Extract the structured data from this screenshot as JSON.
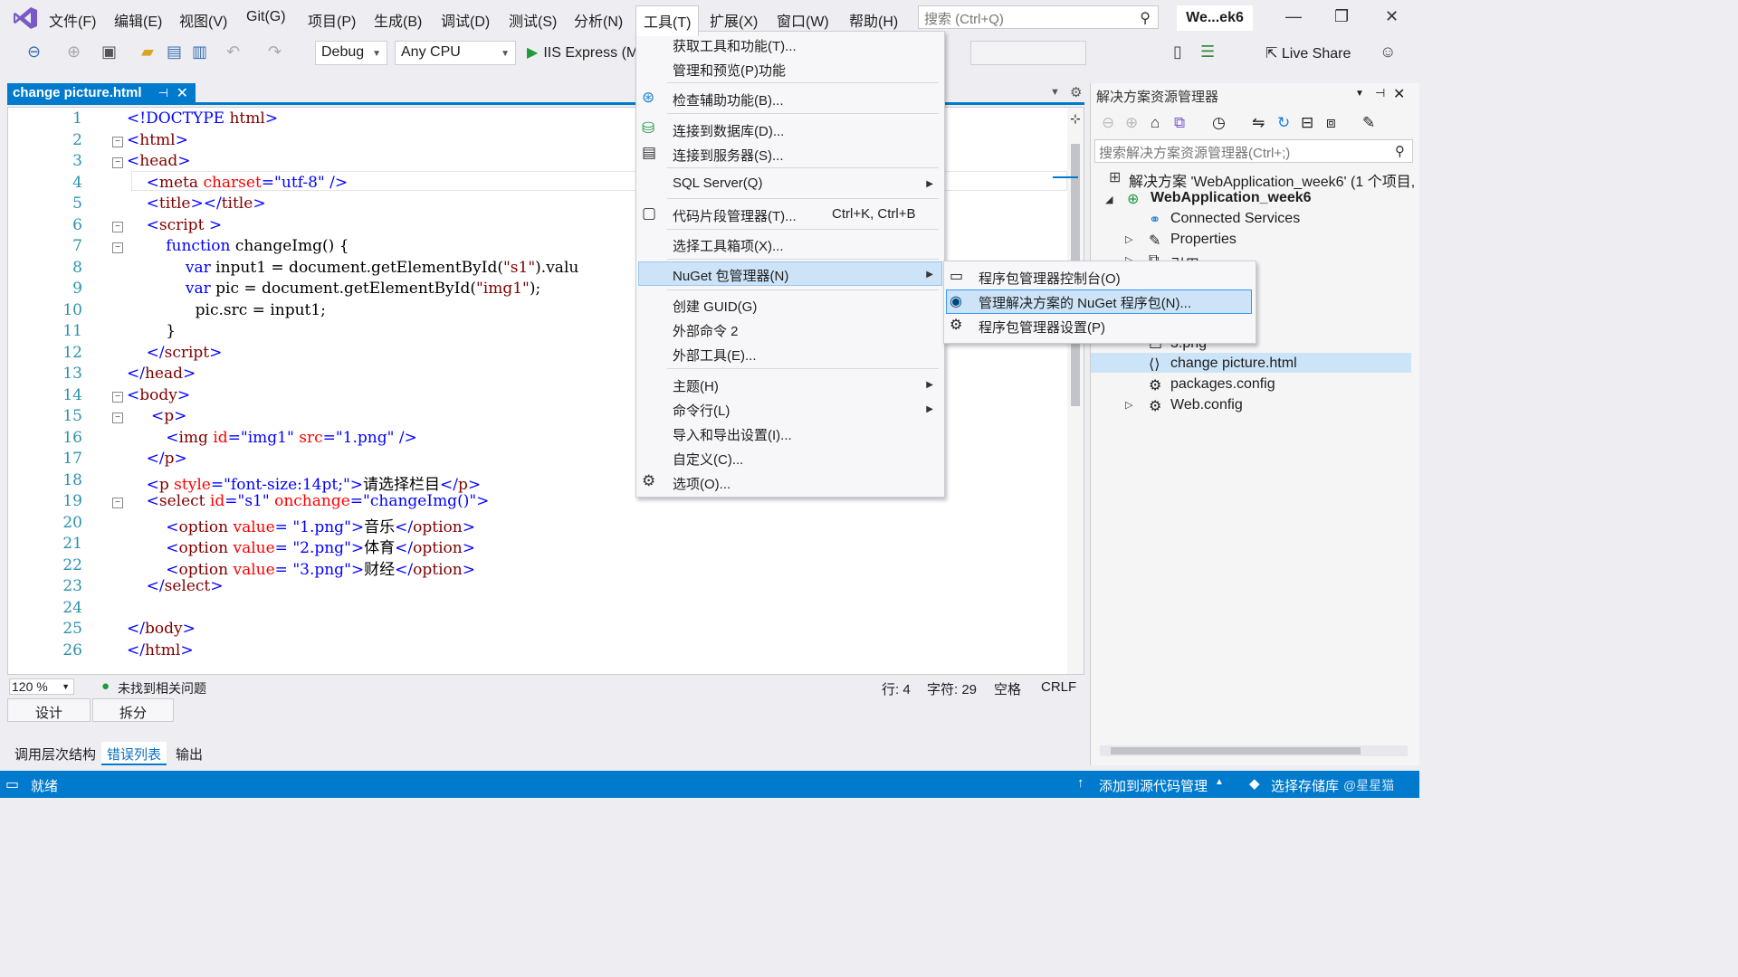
{
  "menubar": [
    "文件(F)",
    "编辑(E)",
    "视图(V)",
    "Git(G)",
    "项目(P)",
    "生成(B)",
    "调试(D)",
    "测试(S)",
    "分析(N)",
    "工具(T)",
    "扩展(X)",
    "窗口(W)",
    "帮助(H)"
  ],
  "search": {
    "placeholder": "搜索 (Ctrl+Q)"
  },
  "solution_short": "We...ek6",
  "toolbar": {
    "config": "Debug",
    "platform": "Any CPU",
    "run": "IIS Express (M",
    "live_share": "Live Share"
  },
  "editor": {
    "tab": "change picture.html",
    "lines": [
      "1",
      "2",
      "3",
      "4",
      "5",
      "6",
      "7",
      "8",
      "9",
      "10",
      "11",
      "12",
      "13",
      "14",
      "15",
      "16",
      "17",
      "18",
      "19",
      "20",
      "21",
      "22",
      "23",
      "24",
      "25",
      "26"
    ],
    "zoom": "120 %",
    "issues": "未找到相关问题",
    "row": "行: 4",
    "col": "字符: 29",
    "space": "空格",
    "eol": "CRLF",
    "design_tab": "设计",
    "split_tab": "拆分"
  },
  "bottom_tabs": [
    "调用层次结构",
    "错误列表",
    "输出"
  ],
  "status": {
    "ready": "就绪",
    "source_control": "添加到源代码管理",
    "repo": "选择存储库",
    "watermark": "@星星猫"
  },
  "tools_menu": {
    "items": [
      "获取工具和功能(T)...",
      "管理和预览(P)功能",
      "检查辅助功能(B)...",
      "连接到数据库(D)...",
      "连接到服务器(S)...",
      "SQL Server(Q)",
      "代码片段管理器(T)...",
      "选择工具箱项(X)...",
      "NuGet 包管理器(N)",
      "创建 GUID(G)",
      "外部命令 2",
      "外部工具(E)...",
      "主题(H)",
      "命令行(L)",
      "导入和导出设置(I)...",
      "自定义(C)...",
      "选项(O)..."
    ],
    "snippet_shortcut": "Ctrl+K, Ctrl+B"
  },
  "nuget_submenu": [
    "程序包管理器控制台(O)",
    "管理解决方案的 NuGet 程序包(N)...",
    "程序包管理器设置(P)"
  ],
  "solution_explorer": {
    "title": "解决方案资源管理器",
    "search_placeholder": "搜索解决方案资源管理器(Ctrl+;)",
    "solution": "解决方案 'WebApplication_week6' (1 个项目,",
    "project": "WebApplication_week6",
    "items": [
      "Connected Services",
      "Properties",
      "引用",
      "3.png",
      "change picture.html",
      "packages.config",
      "Web.config"
    ]
  },
  "colors": {
    "accent": "#007acc",
    "menu_highlight": "#cde3f7"
  }
}
